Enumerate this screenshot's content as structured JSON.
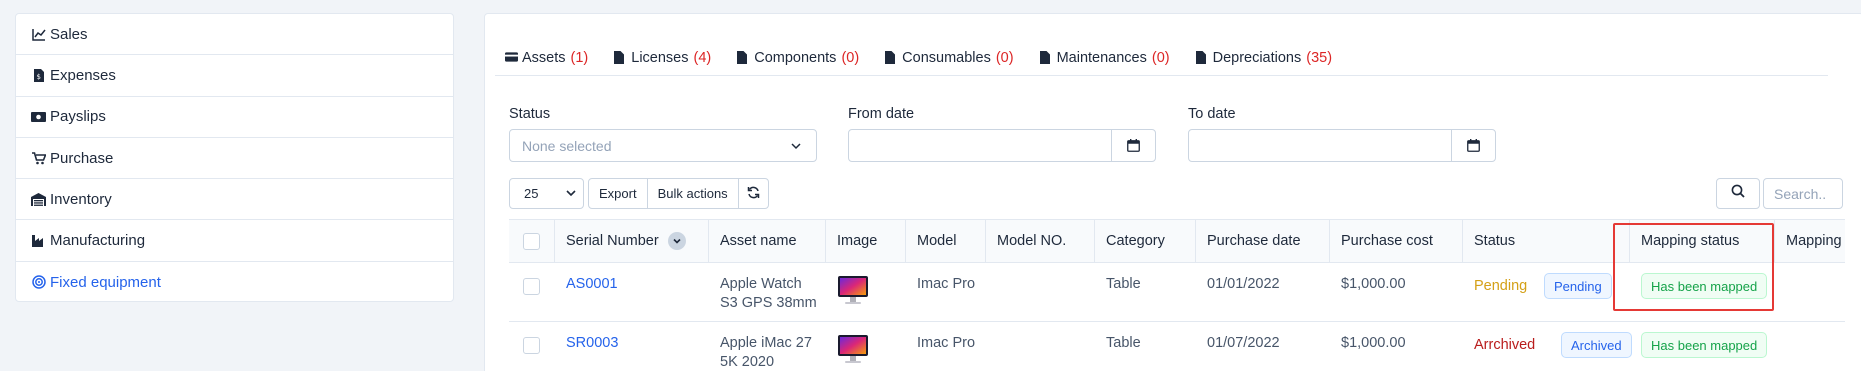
{
  "sidebar": {
    "items": [
      {
        "label": "Sales",
        "icon": "chart-line-icon",
        "active": false
      },
      {
        "label": "Expenses",
        "icon": "file-invoice-icon",
        "active": false
      },
      {
        "label": "Payslips",
        "icon": "money-bill-icon",
        "active": false
      },
      {
        "label": "Purchase",
        "icon": "cart-icon",
        "active": false
      },
      {
        "label": "Inventory",
        "icon": "warehouse-icon",
        "active": false
      },
      {
        "label": "Manufacturing",
        "icon": "industry-icon",
        "active": false
      },
      {
        "label": "Fixed equipment",
        "icon": "target-icon",
        "active": true
      }
    ]
  },
  "tabs": [
    {
      "label": "Assets",
      "count": "(1)",
      "icon": "credit-card-icon"
    },
    {
      "label": "Licenses",
      "count": "(4)",
      "icon": "file-icon"
    },
    {
      "label": "Components",
      "count": "(0)",
      "icon": "file-icon"
    },
    {
      "label": "Consumables",
      "count": "(0)",
      "icon": "file-icon"
    },
    {
      "label": "Maintenances",
      "count": "(0)",
      "icon": "file-icon"
    },
    {
      "label": "Depreciations",
      "count": "(35)",
      "icon": "file-icon"
    }
  ],
  "filters": {
    "status_label": "Status",
    "status_placeholder": "None selected",
    "from_label": "From date",
    "to_label": "To date"
  },
  "toolbar": {
    "page_size": "25",
    "export_label": "Export",
    "bulk_label": "Bulk actions",
    "search_placeholder": "Search.."
  },
  "table": {
    "columns": [
      "Serial Number",
      "Asset name",
      "Image",
      "Model",
      "Model NO.",
      "Category",
      "Purchase date",
      "Purchase cost",
      "Status",
      "Mapping status",
      "Mapping"
    ],
    "rows": [
      {
        "serial": "AS0001",
        "asset_name_1": "Apple Watch",
        "asset_name_2": "S3 GPS 38mm",
        "model": "Imac Pro",
        "model_no": "",
        "category": "Table",
        "purchase_date": "01/01/2022",
        "purchase_cost": "$1,000.00",
        "status_text": "Pending",
        "status_badge": "Pending",
        "mapping_status": "Has been mapped"
      },
      {
        "serial": "SR0003",
        "asset_name_1": "Apple iMac 27",
        "asset_name_2": "5K 2020",
        "model": "Imac Pro",
        "model_no": "",
        "category": "Table",
        "purchase_date": "01/07/2022",
        "purchase_cost": "$1,000.00",
        "status_text": "Arrchived",
        "status_badge": "Archived",
        "mapping_status": "Has been mapped"
      }
    ]
  },
  "colors": {
    "accent": "#2563eb",
    "count_red": "#dc2626",
    "pending": "#d4a017",
    "archived": "#b91c1c",
    "highlight": "#e53935"
  }
}
